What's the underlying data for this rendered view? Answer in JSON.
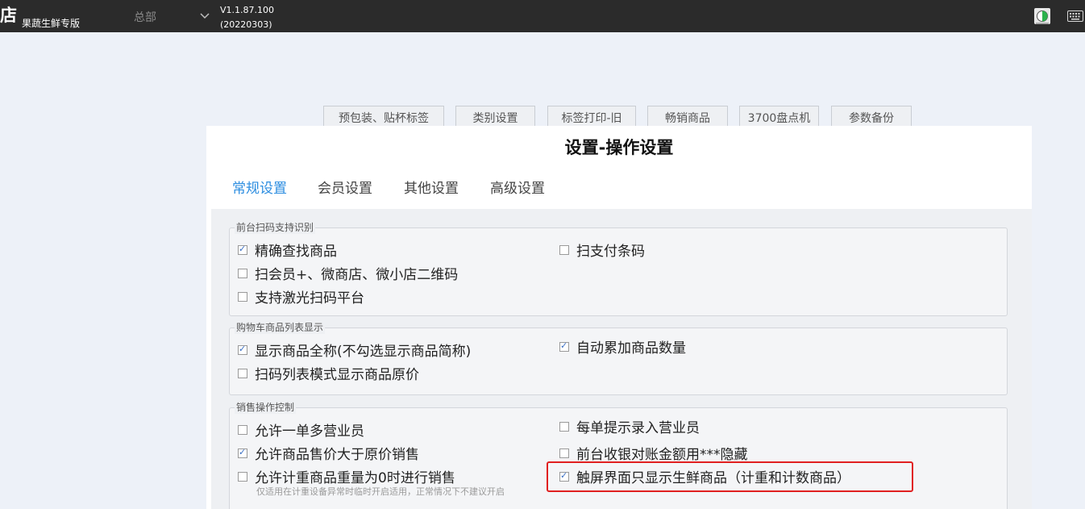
{
  "header": {
    "logo": "店",
    "app_name": "果蔬生鲜专版",
    "store": "总部",
    "version": "V1.1.87.100",
    "build": "(20220303)"
  },
  "top_tabs": [
    "预包装、贴杯标签",
    "类别设置",
    "标签打印-旧",
    "畅销商品",
    "3700盘点机",
    "参数备份"
  ],
  "panel": {
    "title": "设置-操作设置",
    "tabs": [
      "常规设置",
      "会员设置",
      "其他设置",
      "高级设置"
    ],
    "active_tab": "常规设置"
  },
  "groups": {
    "scan": {
      "title": "前台扫码支持识别",
      "items": [
        {
          "label": "精确查找商品",
          "checked": true
        },
        {
          "label": "扫支付条码",
          "checked": false
        },
        {
          "label": "扫会员+、微商店、微小店二维码",
          "checked": false
        },
        {
          "label": "支持激光扫码平台",
          "checked": false
        }
      ]
    },
    "cart": {
      "title": "购物车商品列表显示",
      "items": [
        {
          "label": "显示商品全称(不勾选显示商品简称)",
          "checked": true
        },
        {
          "label": "自动累加商品数量",
          "checked": true
        },
        {
          "label": "扫码列表模式显示商品原价",
          "checked": false
        }
      ]
    },
    "sales": {
      "title": "销售操作控制",
      "items": [
        {
          "label": "允许一单多营业员",
          "checked": false
        },
        {
          "label": "每单提示录入营业员",
          "checked": false
        },
        {
          "label": "允许商品售价大于原价销售",
          "checked": true
        },
        {
          "label": "前台收银对账金额用***隐藏",
          "checked": false
        },
        {
          "label": "允许计重商品重量为0时进行销售",
          "checked": false
        },
        {
          "label": "触屏界面只显示生鲜商品（计重和计数商品）",
          "checked": true
        }
      ],
      "note": "仅适用在计重设备异常时临时开启适用，正常情况下不建议开启"
    }
  },
  "colors": {
    "topbar": "#2b2b2b",
    "accent": "#2c8de0",
    "highlight": "#e02020"
  }
}
